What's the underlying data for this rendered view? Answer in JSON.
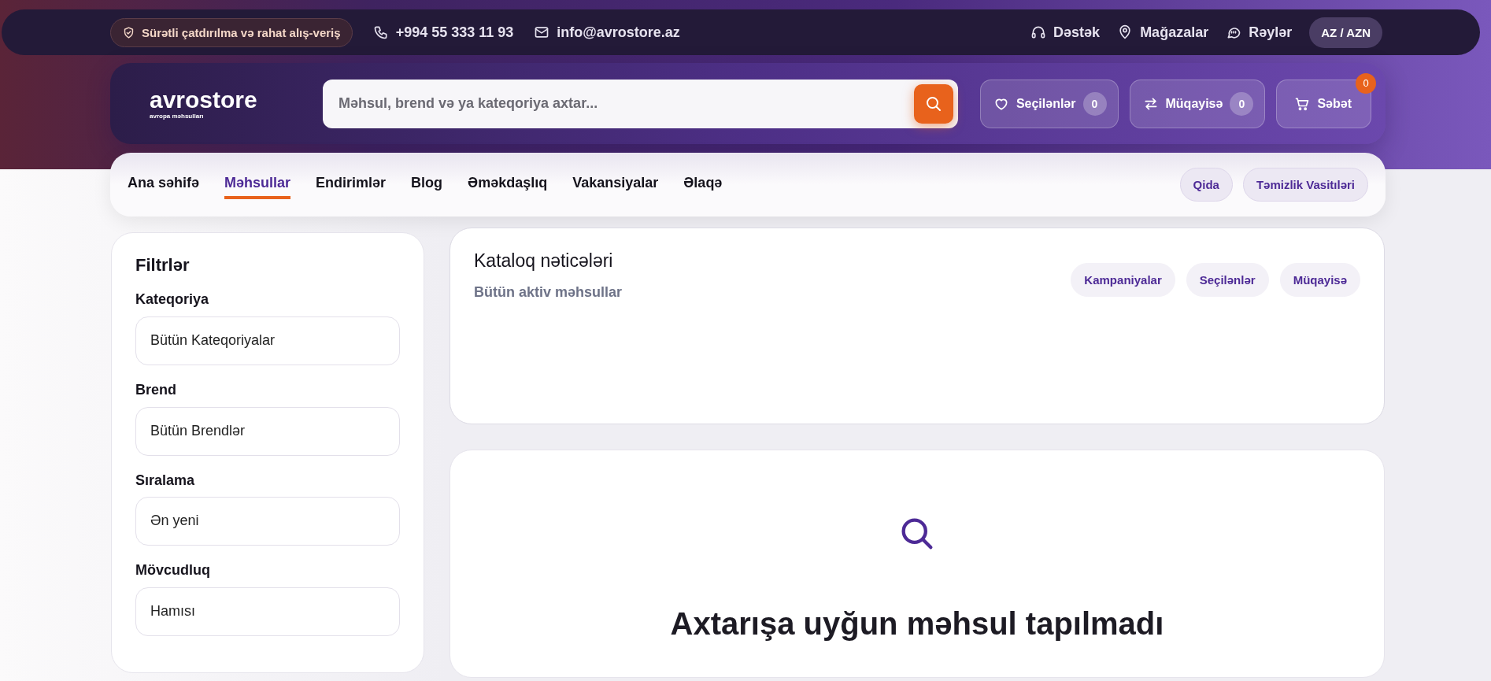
{
  "topbar": {
    "promo": "Sürətli çatdırılma və rahat alış-veriş",
    "phone": "+994 55 333 11 93",
    "email": "info@avrostore.az",
    "links": [
      {
        "kind": "support",
        "label": "Dəstək"
      },
      {
        "kind": "stores",
        "label": "Mağazalar"
      },
      {
        "kind": "reviews",
        "label": "Rəylər"
      }
    ],
    "language": "AZ / AZN"
  },
  "header": {
    "logo": "avrostore",
    "tagline": "avropa məhsulları",
    "search": {
      "placeholder": "Məhsul, brend və ya kateqoriya axtar..."
    },
    "actions": [
      {
        "kind": "favorites",
        "label": "Seçilənlər",
        "count": "0"
      },
      {
        "kind": "compare",
        "label": "Müqayisə",
        "count": "0"
      },
      {
        "kind": "cart",
        "label": "Səbət",
        "badge": "0"
      }
    ]
  },
  "nav": {
    "items": [
      {
        "label": "Ana səhifə",
        "selected": false
      },
      {
        "label": "Məhsullar",
        "selected": true
      },
      {
        "label": "Endirimlər",
        "selected": false
      },
      {
        "label": "Blog",
        "selected": false
      },
      {
        "label": "Əməkdaşlıq",
        "selected": false
      },
      {
        "label": "Vakansiyalar",
        "selected": false
      },
      {
        "label": "Əlaqə",
        "selected": false
      }
    ],
    "chips": [
      "Qida",
      "Təmizlik Vasitıləri"
    ]
  },
  "filters": {
    "title": "Filtrlər",
    "groups": [
      {
        "label": "Kateqoriya",
        "value": "Bütün Kateqoriyalar"
      },
      {
        "label": "Brend",
        "value": "Bütün Brendlər"
      },
      {
        "label": "Sıralama",
        "value": "Ən yeni"
      },
      {
        "label": "Mövcudluq",
        "value": "Hamısı"
      }
    ]
  },
  "catalog": {
    "title": "Kataloq nəticələri",
    "subtitle": "Bütün aktiv məhsullar",
    "links": [
      "Kampaniyalar",
      "Seçilənlər",
      "Müqayisə"
    ]
  },
  "empty": {
    "title": "Axtarışa uyğun məhsul tapılmadı"
  }
}
